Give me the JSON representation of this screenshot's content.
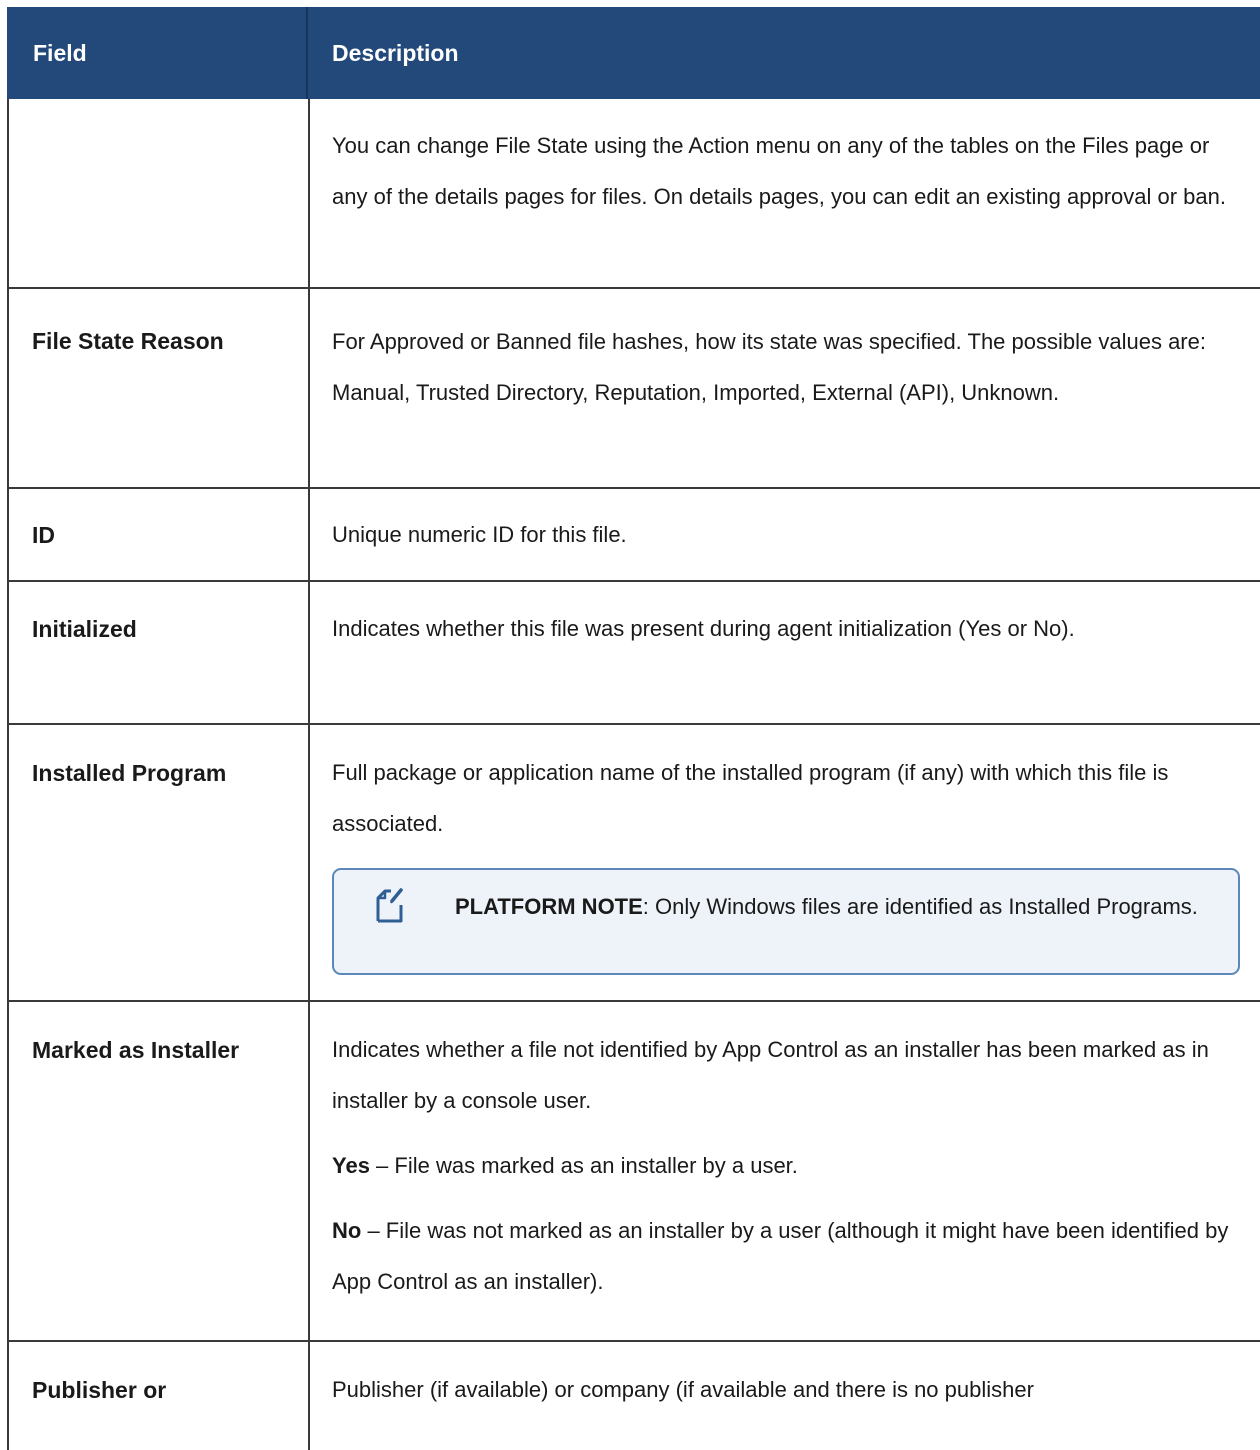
{
  "header": {
    "field": "Field",
    "description": "Description"
  },
  "rows": [
    {
      "field": "",
      "description": "You can change File State using the Action menu on any of the tables on the Files page or any of the details pages for files. On details pages, you can edit an existing approval or ban."
    },
    {
      "field": "File State Reason",
      "description": "For Approved or Banned file hashes, how its state was specified. The possible values are: Manual, Trusted Directory, Reputation, Imported, External (API), Unknown."
    },
    {
      "field": "ID",
      "description": "Unique numeric ID for this file."
    },
    {
      "field": "Initialized",
      "description": "Indicates whether this file was present during agent initialization (Yes or No)."
    },
    {
      "field": "Installed Program",
      "description": "Full package or application name of the installed program (if any) with which this file is associated.",
      "note": {
        "icon": "note-pencil-icon",
        "label": "PLATFORM NOTE",
        "text": ": Only Windows files are identified as Installed Programs."
      }
    },
    {
      "field": "Marked as Installer",
      "description": "Indicates whether a file not identified by App Control as an installer has been marked as in installer by a console user.",
      "yes_label": "Yes",
      "yes_text": " – File was marked as an installer by a user.",
      "no_label": "No",
      "no_text": " – File was not marked as an installer by a user (although it might have been identified by App Control as an installer)."
    },
    {
      "field": "Publisher or",
      "description": "Publisher (if available) or company (if available and there is no publisher"
    }
  ],
  "colors": {
    "header_bg": "#23497a",
    "note_bg": "#eef3f9",
    "note_border": "#5b88b8"
  }
}
